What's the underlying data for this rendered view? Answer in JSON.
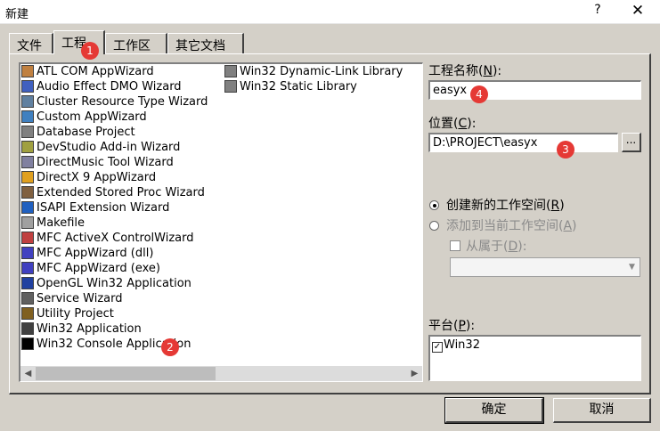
{
  "window": {
    "title": "新建",
    "help_icon": "?",
    "close_icon": "✕"
  },
  "tabs": [
    {
      "label": "文件"
    },
    {
      "label": "工程"
    },
    {
      "label": "工作区"
    },
    {
      "label": "其它文档"
    }
  ],
  "project_types": {
    "column1": [
      {
        "label": "ATL COM AppWizard",
        "icon": "atl-icon",
        "color": "#c08040"
      },
      {
        "label": "Audio Effect DMO Wizard",
        "icon": "audio-icon",
        "color": "#4060c0"
      },
      {
        "label": "Cluster Resource Type Wizard",
        "icon": "cluster-icon",
        "color": "#6080a0"
      },
      {
        "label": "Custom AppWizard",
        "icon": "custom-icon",
        "color": "#4080c0"
      },
      {
        "label": "Database Project",
        "icon": "database-icon",
        "color": "#808080"
      },
      {
        "label": "DevStudio Add-in Wizard",
        "icon": "addin-icon",
        "color": "#a0a040"
      },
      {
        "label": "DirectMusic Tool Wizard",
        "icon": "directmusic-icon",
        "color": "#8080a0"
      },
      {
        "label": "DirectX 9 AppWizard",
        "icon": "directx-icon",
        "color": "#e0a020"
      },
      {
        "label": "Extended Stored Proc Wizard",
        "icon": "stored-proc-icon",
        "color": "#806040"
      },
      {
        "label": "ISAPI Extension Wizard",
        "icon": "isapi-icon",
        "color": "#2060c0"
      },
      {
        "label": "Makefile",
        "icon": "makefile-icon",
        "color": "#a0a0a0"
      },
      {
        "label": "MFC ActiveX ControlWizard",
        "icon": "activex-icon",
        "color": "#c04040"
      },
      {
        "label": "MFC AppWizard (dll)",
        "icon": "mfc-dll-icon",
        "color": "#4040c0"
      },
      {
        "label": "MFC AppWizard (exe)",
        "icon": "mfc-exe-icon",
        "color": "#4040c0"
      },
      {
        "label": "OpenGL Win32 Application",
        "icon": "opengl-icon",
        "color": "#2040a0"
      },
      {
        "label": "Service Wizard",
        "icon": "service-icon",
        "color": "#606060"
      },
      {
        "label": "Utility Project",
        "icon": "utility-icon",
        "color": "#806020"
      },
      {
        "label": "Win32 Application",
        "icon": "win32-app-icon",
        "color": "#404040"
      },
      {
        "label": "Win32 Console Application",
        "icon": "win32-console-icon",
        "color": "#000000"
      }
    ],
    "column2": [
      {
        "label": "Win32 Dynamic-Link Library",
        "icon": "win32-dll-icon",
        "color": "#808080"
      },
      {
        "label": "Win32 Static Library",
        "icon": "win32-lib-icon",
        "color": "#808080"
      }
    ]
  },
  "form": {
    "project_name_label": "工程名称(",
    "project_name_key": "N",
    "project_name_suffix": "):",
    "project_name_value": "easyx",
    "location_label": "位置(",
    "location_key": "C",
    "location_suffix": "):",
    "location_value": "D:\\PROJECT\\easyx",
    "browse_label": "...",
    "radio_new_label": "创建新的工作空间(",
    "radio_new_key": "R",
    "radio_add_label": "添加到当前工作空间(",
    "radio_add_key": "A",
    "dependency_label": "从属于(",
    "dependency_key": "D",
    "close_paren": ")",
    "close_paren_colon": "):",
    "platform_label": "平台(",
    "platform_key": "P",
    "platform_check": "✓",
    "platform_item": "Win32"
  },
  "buttons": {
    "ok": "确定",
    "cancel": "取消"
  },
  "annotations": {
    "one": "1",
    "two": "2",
    "three": "3",
    "four": "4",
    "color": "#e53935"
  }
}
